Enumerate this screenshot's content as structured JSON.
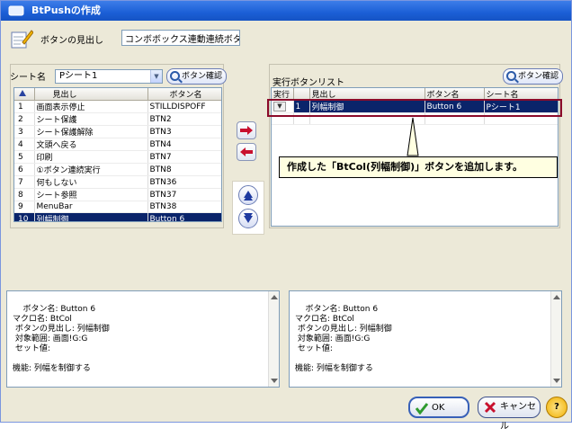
{
  "window": {
    "title": "BtPushの作成"
  },
  "header": {
    "label": "ボタンの見出し",
    "value": "コンボボックス連動連続ボタン"
  },
  "left_panel": {
    "sheet_label": "シート名",
    "sheet_value": "Pシート1",
    "confirm_button": "ボタン確認",
    "columns": [
      "",
      "見出し",
      "ボタン名"
    ],
    "rows": [
      {
        "no": "1",
        "heading": "画面表示停止",
        "button": "STILLDISPOFF"
      },
      {
        "no": "2",
        "heading": "シート保護",
        "button": "BTN2"
      },
      {
        "no": "3",
        "heading": "シート保護解除",
        "button": "BTN3"
      },
      {
        "no": "4",
        "heading": "文頭へ戻る",
        "button": "BTN4"
      },
      {
        "no": "5",
        "heading": "印刷",
        "button": "BTN7"
      },
      {
        "no": "6",
        "heading": "①ボタン連続実行",
        "button": "BTN8"
      },
      {
        "no": "7",
        "heading": "何もしない",
        "button": "BTN36"
      },
      {
        "no": "8",
        "heading": "シート参照",
        "button": "BTN37"
      },
      {
        "no": "9",
        "heading": "MenuBar",
        "button": "BTN38"
      },
      {
        "no": "10",
        "heading": "列幅制御",
        "button": "Button 6"
      }
    ],
    "selected_index": 9
  },
  "right_panel": {
    "label": "実行ボタンリスト",
    "confirm_button": "ボタン確認",
    "columns": [
      "実行",
      "",
      "見出し",
      "ボタン名",
      "シート名"
    ],
    "rows": [
      {
        "exec": "",
        "no": "1",
        "heading": "列幅制御",
        "button": "Button 6",
        "sheet": "Pシート1"
      }
    ]
  },
  "callout": {
    "text": "作成した「BtCol(列幅制御)」ボタンを追加します。"
  },
  "info_left": {
    "text": "ボタン名: Button 6\nマクロ名: BtCol\n ボタンの見出し: 列幅制御\n 対象範囲: 画面!G:G\n セット値:\n\n機能: 列幅を制御する"
  },
  "info_right": {
    "text": "ボタン名: Button 6\nマクロ名: BtCol\n ボタンの見出し: 列幅制御\n 対象範囲: 画面!G:G\n セット値:\n\n機能: 列幅を制御する"
  },
  "footer": {
    "ok_label": "OK",
    "cancel_label": "キャンセル",
    "help_label": "?"
  },
  "colors": {
    "selection": "#0a246a",
    "title_bar": "#1b5fd6",
    "callout_bg": "#ffffe1",
    "highlight_border": "#8b0a2a",
    "arrow_red": "#c8102e"
  },
  "icons": [
    "pencil-notepad-icon",
    "magnifier-icon",
    "right-arrow-icon",
    "left-arrow-icon",
    "up-arrow-icon",
    "down-arrow-icon",
    "check-icon",
    "cross-icon",
    "help-icon"
  ]
}
